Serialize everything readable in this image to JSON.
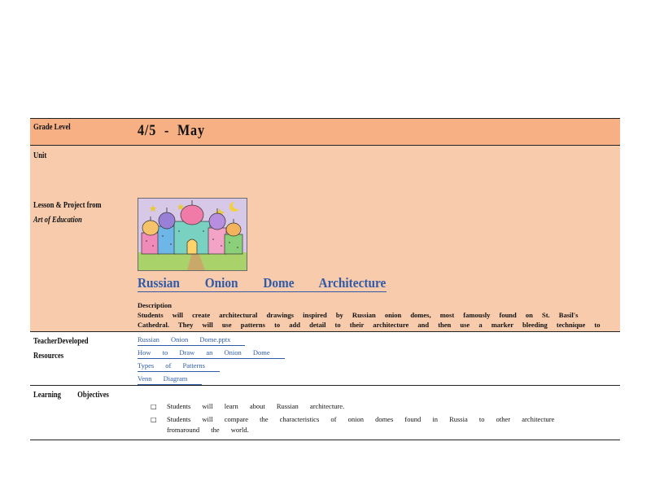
{
  "grade": {
    "label": "Grade Level",
    "value": "4/5  -  May"
  },
  "unit": {
    "label": "Unit",
    "lesson_label_prefix": "Lesson & Project from",
    "lesson_label_source": "Art of Education",
    "title": "Russian Onion Dome Architecture",
    "description_heading": "Description",
    "description": "Students will create architectural drawings inspired by Russian onion domes, most famously found on St. Basil's Cathedral. They will use patterns to add detail to their architecture and then use a marker bleeding technique to add bold color to thei r buildings."
  },
  "resources": {
    "label": "TeacherDeveloped Resources",
    "links": [
      "Russian Onion Dome.pptx",
      "How to Draw an Onion Dome",
      "Types of Patterns",
      "Venn Diagram"
    ]
  },
  "objectives": {
    "label": "Learning Objectives",
    "items": [
      "Students will learn about Russian architecture.",
      "Students will compare the characteristics of onion domes found in Russia to other architecture fromaround the world."
    ]
  },
  "icons": {
    "bullet": "square-bullet-icon",
    "artwork": "onion-dome-drawing-image"
  },
  "colors": {
    "grade_row": "#f6b084",
    "unit_row": "#f7cbac",
    "link": "#2f5aa8"
  }
}
